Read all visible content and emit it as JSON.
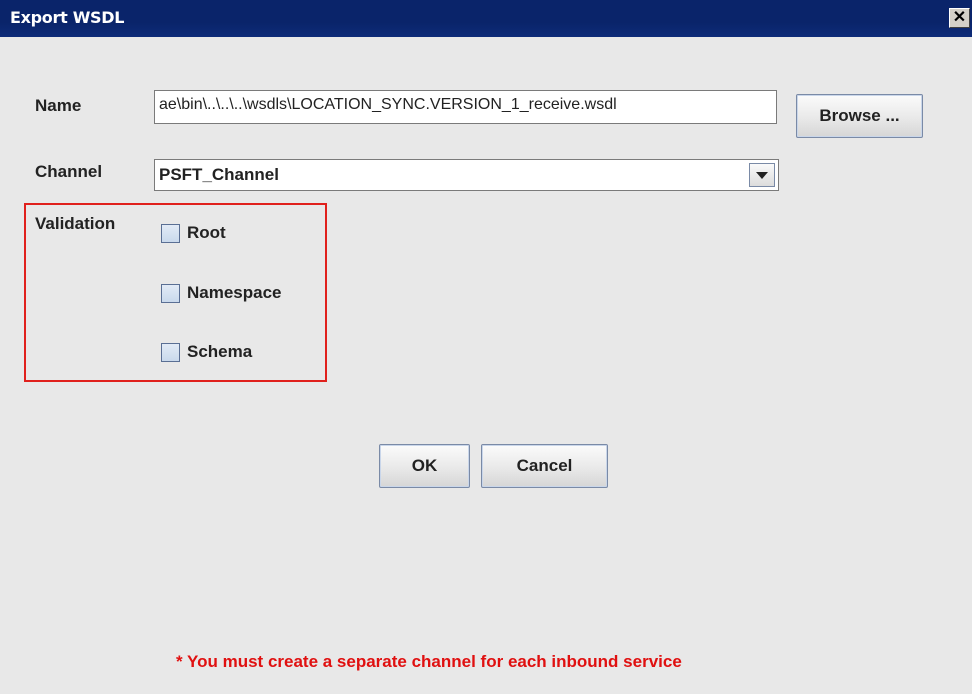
{
  "window": {
    "title": "Export WSDL",
    "close_glyph": "✕"
  },
  "form": {
    "name_label": "Name",
    "name_value": "ae\\bin\\..\\..\\..\\wsdls\\LOCATION_SYNC.VERSION_1_receive.wsdl",
    "browse_label": "Browse ...",
    "channel_label": "Channel",
    "channel_value": "PSFT_Channel",
    "validation_label": "Validation",
    "validation_options": [
      {
        "label": "Root",
        "checked": false
      },
      {
        "label": "Namespace",
        "checked": false
      },
      {
        "label": "Schema",
        "checked": false
      }
    ]
  },
  "actions": {
    "ok_label": "OK",
    "cancel_label": "Cancel"
  },
  "footer_note": "* You must create a separate channel for each inbound service",
  "colors": {
    "titlebar": "#0a246a",
    "highlight": "#e0201c",
    "note": "#e01010",
    "background": "#e8e8e8"
  },
  "icons": {
    "close": "close-icon",
    "dropdown": "chevron-down-icon"
  }
}
